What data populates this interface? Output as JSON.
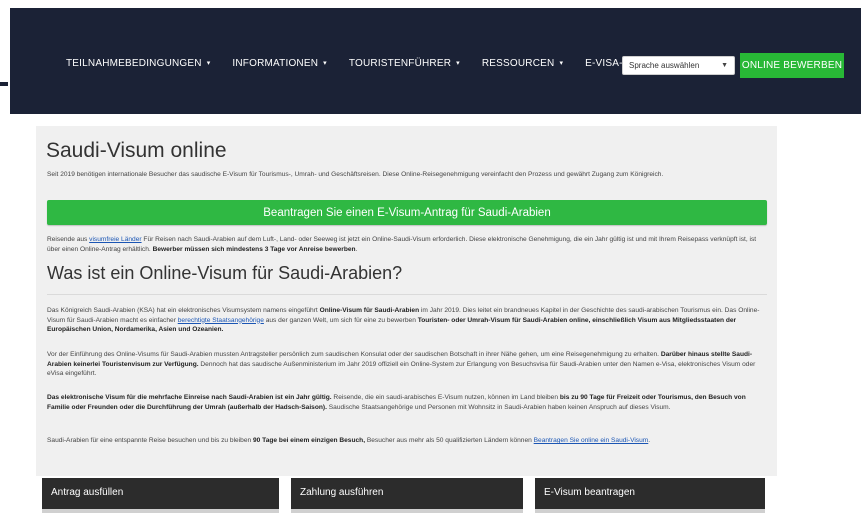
{
  "nav": {
    "items": [
      {
        "label": "TEILNAHMEBEDINGUNGEN",
        "caret": "▾"
      },
      {
        "label": "INFORMATIONEN",
        "caret": "▾"
      },
      {
        "label": "TOURISTENFÜHRER",
        "caret": "▾"
      },
      {
        "label": "RESSOURCEN",
        "caret": "▾"
      },
      {
        "label": "E-VISA-STATUS",
        "caret": ""
      }
    ],
    "language_select": "Sprache auswählen",
    "apply_button": "ONLINE BEWERBEN"
  },
  "main": {
    "title": "Saudi-Visum online",
    "intro": "Seit 2019 benötigen internationale Besucher das saudische E-Visum für Tourismus-, Umrah- und Geschäftsreisen. Diese Online-Reisegenehmigung vereinfacht den Prozess und gewährt Zugang zum Königreich.",
    "cta": "Beantragen Sie einen E-Visum-Antrag für Saudi-Arabien",
    "p1": {
      "a": "Reisende aus ",
      "link": "visumfreie Länder",
      "b": " Für Reisen nach Saudi-Arabien auf dem Luft-, Land- oder Seeweg ist jetzt ein Online-Saudi-Visum erforderlich. Diese elektronische Genehmigung, die ein Jahr gültig ist und mit Ihrem Reisepass verknüpft ist, ist über einen Online-Antrag erhältlich. ",
      "bold": "Bewerber müssen sich mindestens 3 Tage vor Anreise bewerben",
      "end": "."
    },
    "subtitle": "Was ist ein Online-Visum für Saudi-Arabien?",
    "p2": {
      "a": "Das Königreich Saudi-Arabien (KSA) hat ein elektronisches Visumsystem namens eingeführt ",
      "bold1": "Online-Visum für Saudi-Arabien",
      "b": " im Jahr 2019. Dies leitet ein brandneues Kapitel in der Geschichte des saudi-arabischen Tourismus ein. Das Online-Visum für Saudi-Arabien macht es einfacher ",
      "link": "berechtigte Staatsangehörige",
      "c": " aus der ganzen Welt, um sich für eine zu bewerben ",
      "bold2": "Touristen- oder Umrah-Visum für Saudi-Arabien online, einschließlich Visum aus Mitgliedsstaaten der Europäischen Union, Nordamerika, Asien und Ozeanien."
    },
    "p3": {
      "a": "Vor der Einführung des Online-Visums für Saudi-Arabien mussten Antragsteller persönlich zum saudischen Konsulat oder der saudischen Botschaft in ihrer Nähe gehen, um eine Reisegenehmigung zu erhalten. ",
      "bold": "Darüber hinaus stellte Saudi-Arabien keinerlei Touristenvisum zur Verfügung.",
      "b": " Dennoch hat das saudische Außenministerium im Jahr 2019 offiziell ein Online-System zur Erlangung von Besuchsvisa für Saudi-Arabien unter den Namen e-Visa, elektronisches Visum oder eVisa eingeführt."
    },
    "p4": {
      "bold1": "Das elektronische Visum für die mehrfache Einreise nach Saudi-Arabien ist ein Jahr gültig.",
      "a": " Reisende, die ein saudi-arabisches E-Visum nutzen, können im Land bleiben ",
      "bold2": "bis zu 90 Tage für Freizeit oder Tourismus, den Besuch von Familie oder Freunden oder die Durchführung der Umrah (außerhalb der Hadsch-Saison).",
      "b": " Saudische Staatsangehörige und Personen mit Wohnsitz in Saudi-Arabien haben keinen Anspruch auf dieses Visum."
    },
    "p5": {
      "a": "Saudi-Arabien für eine entspannte Reise besuchen und bis zu bleiben ",
      "bold": "90 Tage bei einem einzigen Besuch,",
      "b": " Besucher aus mehr als 50 qualifizierten Ländern können ",
      "link": "Beantragen Sie online ein Saudi-Visum",
      "end": "."
    }
  },
  "steps": [
    {
      "label": "Antrag ausfüllen"
    },
    {
      "label": "Zahlung ausführen"
    },
    {
      "label": "E-Visum beantragen"
    }
  ]
}
